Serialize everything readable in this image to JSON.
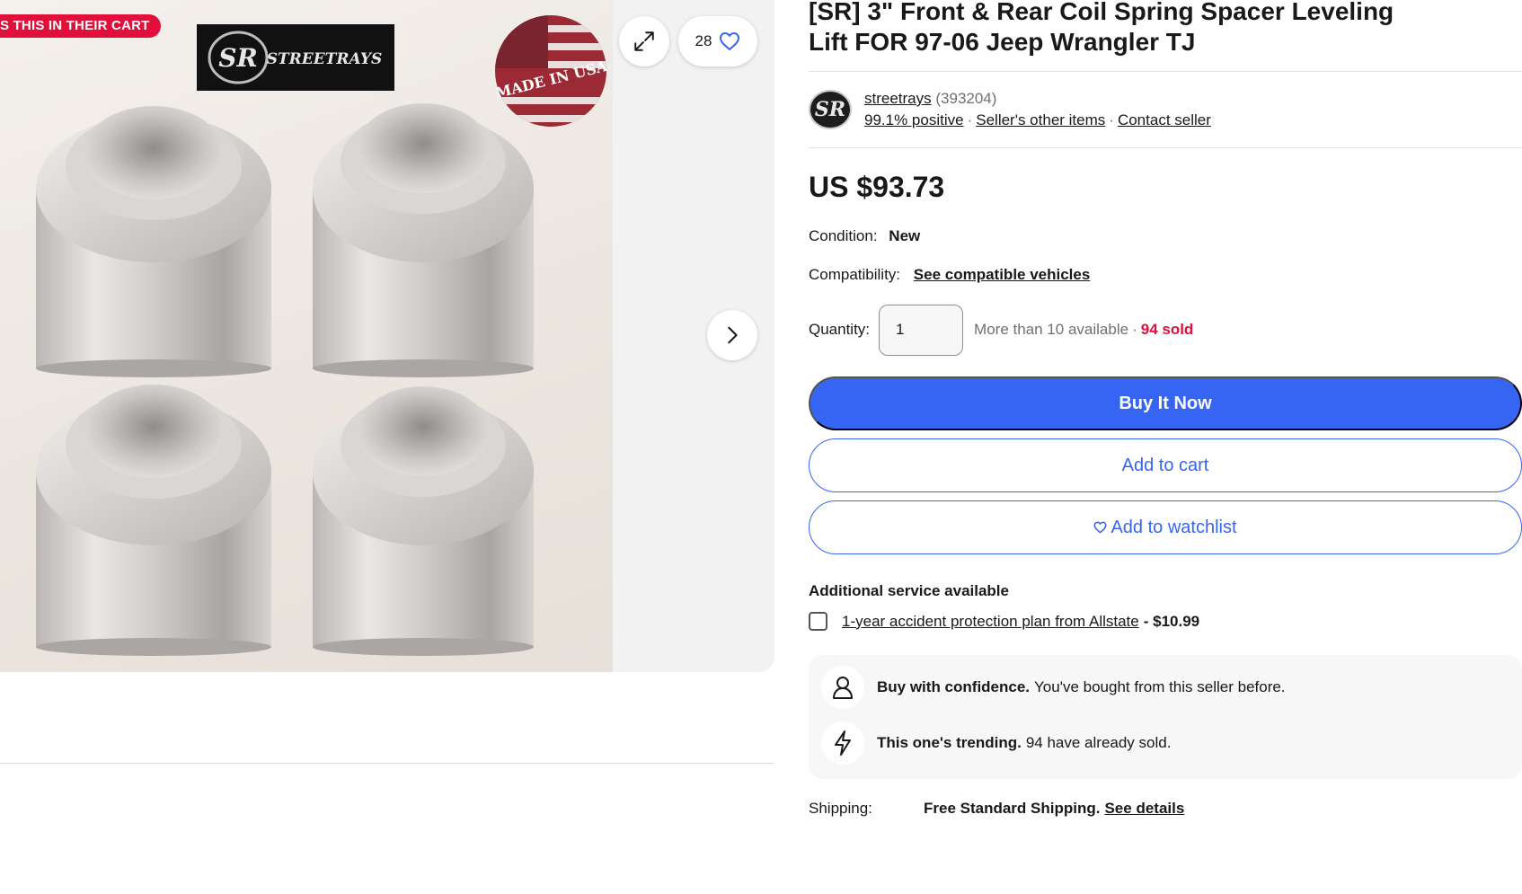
{
  "gallery": {
    "cart_badge": "S THIS IN THEIR CART",
    "brand_logo_text": "STREETRAYS",
    "brand_logo_initials": "SR",
    "seal_text": "MADE IN USA",
    "watch_count": "28"
  },
  "listing": {
    "title": "[SR] 3\" Front & Rear Coil Spring Spacer Leveling Lift FOR 97-06 Jeep Wrangler TJ",
    "seller": {
      "avatar_initials": "SR",
      "name": "streetrays",
      "feedback_count": "(393204)",
      "positive": "99.1% positive",
      "other_items": "Seller's other items",
      "contact": "Contact seller"
    },
    "price": "US $93.73",
    "condition_label": "Condition:",
    "condition_value": "New",
    "compat_label": "Compatibility:",
    "compat_link": "See compatible vehicles",
    "quantity_label": "Quantity:",
    "quantity_value": "1",
    "availability": "More than 10 available",
    "sold": "94 sold",
    "buy_now": "Buy It Now",
    "add_to_cart": "Add to cart",
    "add_to_watchlist": "Add to watchlist",
    "additional_title": "Additional service available",
    "protection_plan": "1-year accident protection plan from Allstate",
    "protection_price": "- $10.99",
    "confidence_bold": "Buy with confidence.",
    "confidence_text": "You've bought from this seller before.",
    "trending_bold": "This one's trending.",
    "trending_text": "94 have already sold.",
    "shipping_label": "Shipping:",
    "shipping_value": "Free Standard Shipping.",
    "shipping_link": "See details"
  },
  "colors": {
    "accent": "#3665f3",
    "badge": "#e0103a",
    "sold": "#e0103a"
  },
  "icons": [
    "expand-icon",
    "heart-icon",
    "chevron-right-icon",
    "person-icon",
    "lightning-icon"
  ]
}
